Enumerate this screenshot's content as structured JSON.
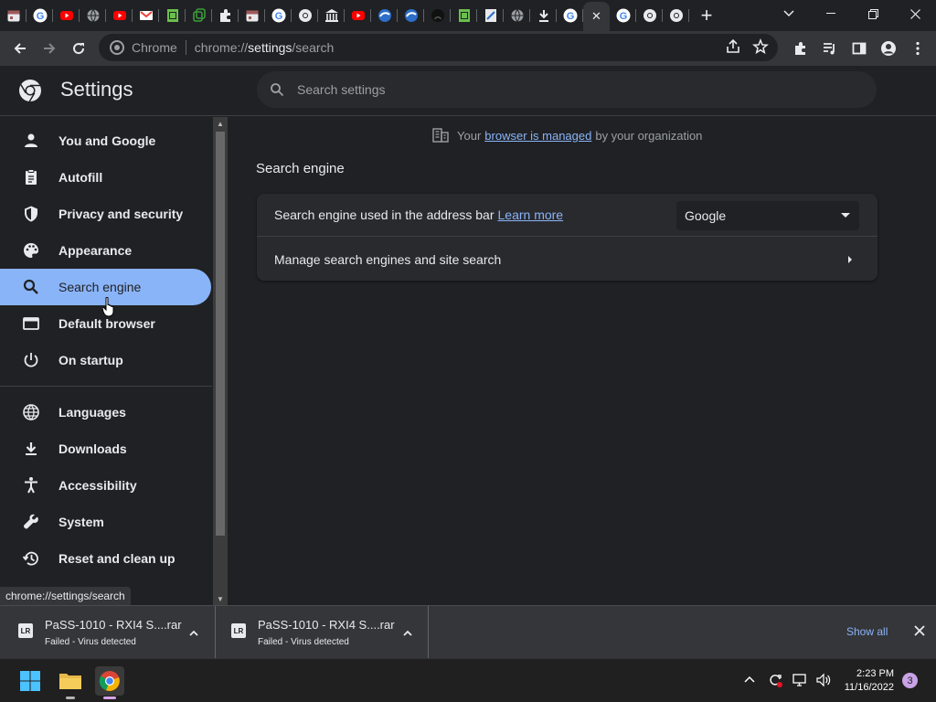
{
  "browser": {
    "tabs": [
      {
        "icon": "calendar-icon",
        "color": "#a05a5a"
      },
      {
        "icon": "google-icon",
        "color": "#ffffff"
      },
      {
        "icon": "youtube-icon",
        "color": "#ff0000"
      },
      {
        "icon": "globe-icon",
        "color": "#9aa0a6"
      },
      {
        "icon": "youtube-icon",
        "color": "#ff0000"
      },
      {
        "icon": "gmail-icon",
        "color": "#ea4335"
      },
      {
        "icon": "sheet-icon",
        "color": "#6bbf4e"
      },
      {
        "icon": "copy-icon",
        "color": "#3a9b3a"
      },
      {
        "icon": "extension-icon",
        "color": "#e8eaed"
      },
      {
        "icon": "calendar-icon",
        "color": "#a05a5a"
      },
      {
        "icon": "google-icon",
        "color": "#ffffff"
      },
      {
        "icon": "chrome-icon",
        "color": "#e8eaed"
      },
      {
        "icon": "bank-icon",
        "color": "#e8eaed"
      },
      {
        "icon": "youtube-icon",
        "color": "#ff0000"
      },
      {
        "icon": "tfa-icon",
        "color": "#2c6ec8"
      },
      {
        "icon": "tfa-icon",
        "color": "#2c6ec8"
      },
      {
        "icon": "github-icon",
        "color": "#202124"
      },
      {
        "icon": "sheet-icon",
        "color": "#6bbf4e"
      },
      {
        "icon": "doc-icon",
        "color": "#e8eaed"
      },
      {
        "icon": "globe-icon",
        "color": "#9aa0a6"
      },
      {
        "icon": "download-icon",
        "color": "#e8eaed"
      },
      {
        "icon": "google-icon",
        "color": "#ffffff"
      }
    ],
    "tabs_after": [
      {
        "icon": "google-icon",
        "color": "#ffffff"
      },
      {
        "icon": "chrome-icon",
        "color": "#e8eaed"
      },
      {
        "icon": "chrome-icon",
        "color": "#e8eaed"
      }
    ],
    "active_tab_close": "✕",
    "new_tab": "+",
    "omnibox": {
      "site_label": "Chrome",
      "url_prefix": "chrome://",
      "url_bold": "settings",
      "url_suffix": "/search"
    }
  },
  "settings": {
    "title": "Settings",
    "search_placeholder": "Search settings",
    "nav": [
      {
        "label": "You and Google",
        "icon": "person-icon"
      },
      {
        "label": "Autofill",
        "icon": "clipboard-icon"
      },
      {
        "label": "Privacy and security",
        "icon": "shield-icon"
      },
      {
        "label": "Appearance",
        "icon": "palette-icon"
      },
      {
        "label": "Search engine",
        "icon": "search-icon",
        "selected": true
      },
      {
        "label": "Default browser",
        "icon": "browser-icon"
      },
      {
        "label": "On startup",
        "icon": "power-icon"
      },
      {
        "label": "Languages",
        "icon": "globe-icon"
      },
      {
        "label": "Downloads",
        "icon": "download-icon"
      },
      {
        "label": "Accessibility",
        "icon": "accessibility-icon"
      },
      {
        "label": "System",
        "icon": "wrench-icon"
      },
      {
        "label": "Reset and clean up",
        "icon": "history-icon"
      }
    ],
    "managed": {
      "prefix": "Your",
      "link": "browser is managed",
      "suffix": "by your organization"
    },
    "section_title": "Search engine",
    "row_address_bar": {
      "label": "Search engine used in the address bar",
      "link": "Learn more",
      "selected_value": "Google"
    },
    "row_manage": {
      "label": "Manage search engines and site search"
    }
  },
  "status_url": "chrome://settings/search",
  "downloads": {
    "items": [
      {
        "name": "PaSS-1010 - RXI4 S....rar",
        "status": "Failed - Virus detected"
      },
      {
        "name": "PaSS-1010 - RXI4 S....rar",
        "status": "Failed - Virus detected"
      }
    ],
    "show_all": "Show all"
  },
  "taskbar": {
    "time": "2:23 PM",
    "date": "11/16/2022",
    "notification_count": "3"
  }
}
